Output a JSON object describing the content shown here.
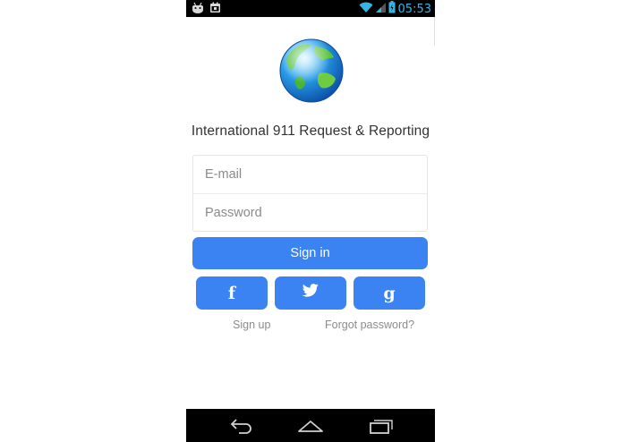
{
  "status_bar": {
    "time": "05:53",
    "left_icons": [
      "android-icon",
      "calendar-icon"
    ],
    "right_icons": [
      "wifi-icon",
      "signal-icon",
      "battery-icon"
    ]
  },
  "app": {
    "logo": "globe-icon",
    "title": "International 911 Request & Reporting"
  },
  "form": {
    "email_placeholder": "E-mail",
    "password_placeholder": "Password",
    "email_value": "",
    "password_value": ""
  },
  "buttons": {
    "sign_in": "Sign in",
    "facebook_glyph": "f",
    "google_glyph": "g"
  },
  "links": {
    "sign_up": "Sign up",
    "forgot_password": "Forgot password?"
  },
  "colors": {
    "accent": "#3b82f2",
    "status_icons": "#33b5e5"
  }
}
